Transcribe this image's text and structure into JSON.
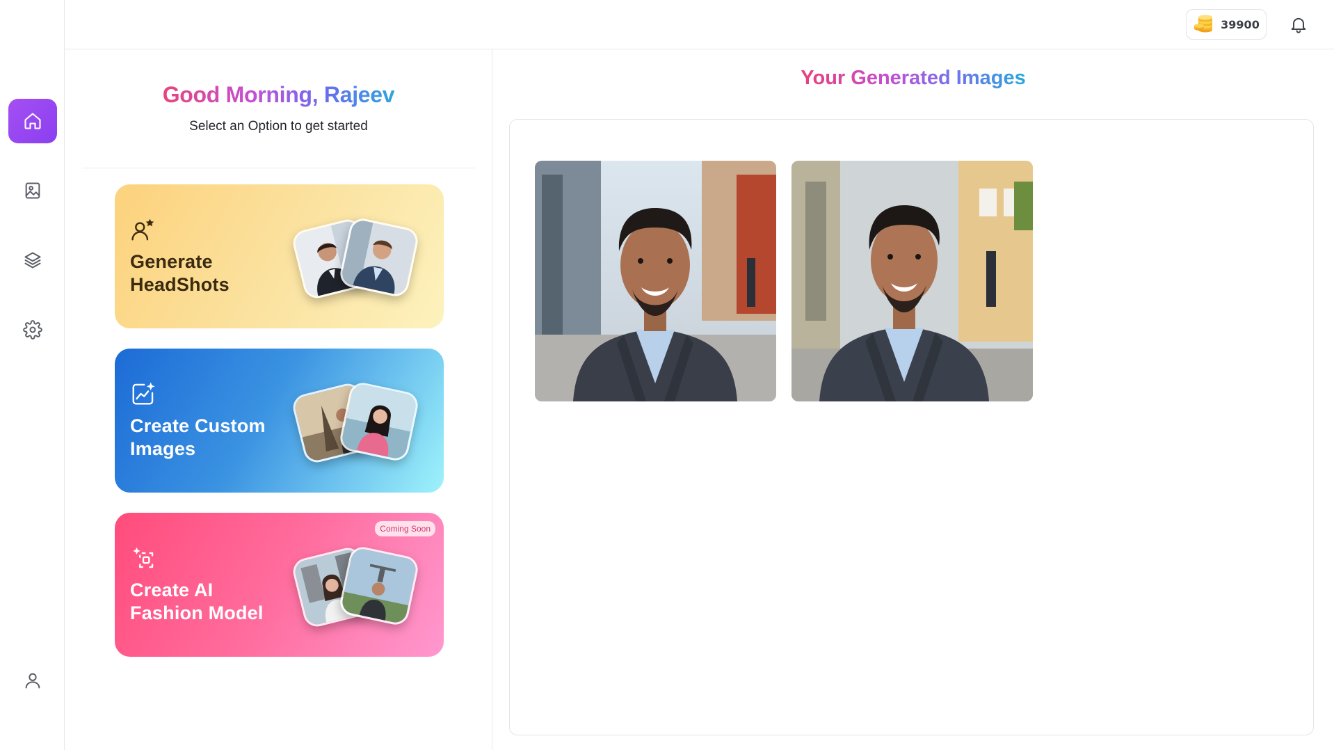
{
  "credits": {
    "amount": "39900",
    "icon": "coins-stack-icon"
  },
  "sidebar": {
    "items": [
      {
        "name": "home",
        "icon": "home-icon",
        "active": true
      },
      {
        "name": "gallery",
        "icon": "image-icon",
        "active": false
      },
      {
        "name": "layers",
        "icon": "layers-icon",
        "active": false
      },
      {
        "name": "settings",
        "icon": "gear-icon",
        "active": false
      },
      {
        "name": "profile",
        "icon": "user-icon",
        "active": false
      }
    ],
    "accent_color": "#9b4af1"
  },
  "greeting": {
    "title": "Good Morning, Rajeev",
    "subtitle": "Select an Option to get started"
  },
  "options": [
    {
      "title": "Generate HeadShots",
      "icon": "user-star-icon",
      "badge": ""
    },
    {
      "title": "Create Custom Images",
      "icon": "sparkle-chart-icon",
      "badge": ""
    },
    {
      "title": "Create AI Fashion Model",
      "icon": "sparkle-frame-icon",
      "badge": "Coming Soon"
    }
  ],
  "generated": {
    "title": "Your Generated Images",
    "images": [
      {
        "alt": "headshot-1"
      },
      {
        "alt": "headshot-2"
      }
    ]
  }
}
